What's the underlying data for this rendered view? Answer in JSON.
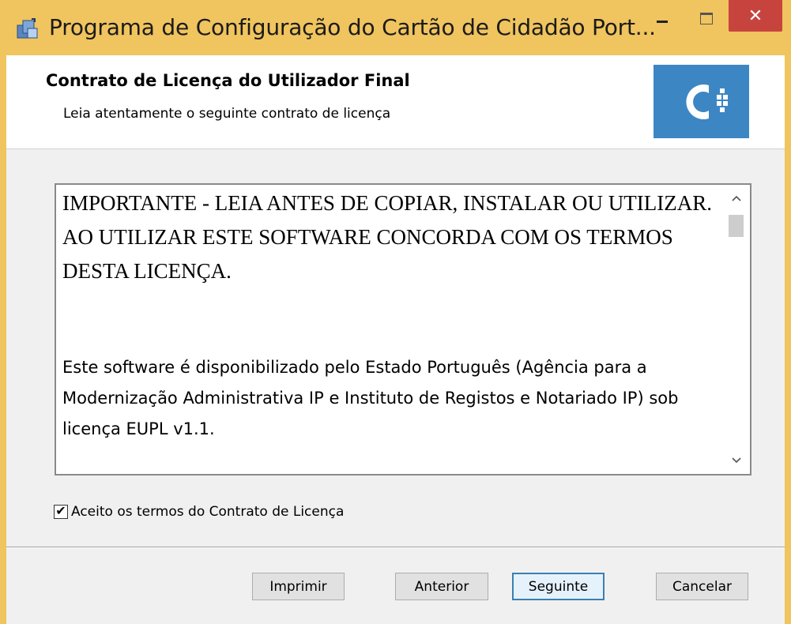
{
  "window": {
    "title": "Programa de Configuração do Cartão de Cidadão Port...",
    "minimize_icon": "minimize-icon",
    "maximize_icon": "maximize-icon",
    "close_icon": "close-icon",
    "close_glyph": "✕",
    "colors": {
      "frame": "#f0c45e",
      "close": "#c7443e"
    }
  },
  "header": {
    "title": "Contrato de Licença do Utilizador Final",
    "subtitle": "Leia atentamente o seguinte contrato de licença",
    "logo_icon": "cartao-cidadao-logo-icon",
    "logo_color": "#3d86c4"
  },
  "license": {
    "paragraph1": "IMPORTANTE - LEIA ANTES DE COPIAR, INSTALAR OU UTILIZAR. AO UTILIZAR ESTE SOFTWARE CONCORDA COM OS TERMOS DESTA LICENÇA.",
    "paragraph2": "Este software é disponibilizado pelo Estado Português (Agência para a Modernização Administrativa IP e Instituto de Registos e Notariado IP) sob licença EUPL v1.1.",
    "scroll_up_glyph": "^",
    "scroll_down_glyph": "v"
  },
  "accept": {
    "checked": true,
    "check_glyph": "✔",
    "label": "Aceito os termos do Contrato de Licença"
  },
  "buttons": {
    "print": "Imprimir",
    "previous": "Anterior",
    "next": "Seguinte",
    "cancel": "Cancelar"
  }
}
